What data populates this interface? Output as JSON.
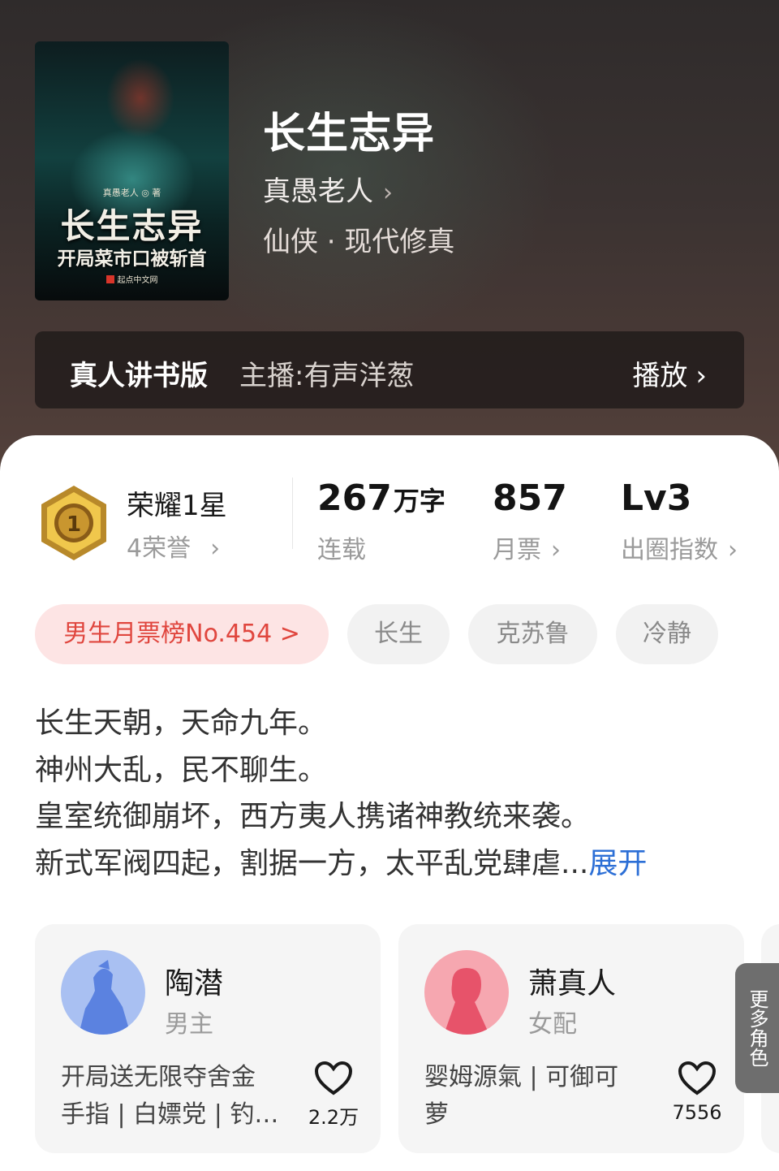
{
  "book": {
    "title": "长生志异",
    "author": "真愚老人",
    "genre": "仙侠 · 现代修真",
    "cover": {
      "author_line": "真愚老人 ◎ 著",
      "title": "长生志异",
      "subtitle": "开局菜市口被斩首",
      "publisher": "起点中文网"
    }
  },
  "audio": {
    "label": "真人讲书版",
    "anchor": "主播:有声洋葱",
    "play_label": "播放"
  },
  "honor": {
    "title": "荣耀1星",
    "sub": "4荣誉",
    "badge_number": "1"
  },
  "stats": [
    {
      "value": "267",
      "unit": "万字",
      "label": "连载"
    },
    {
      "value": "857",
      "unit": "",
      "label": "月票"
    },
    {
      "value": "Lv3",
      "unit": "",
      "label": "出圈指数"
    }
  ],
  "tags": [
    {
      "label": "男生月票榜No.454 >"
    },
    {
      "label": "长生"
    },
    {
      "label": "克苏鲁"
    },
    {
      "label": "冷静"
    }
  ],
  "synopsis": {
    "lines": [
      "长生天朝，天命九年。",
      "神州大乱，民不聊生。",
      "皇室统御崩坏，西方夷人携诸神教统来袭。",
      "新式军阀四起，割据一方，太平乱党肆虐..."
    ],
    "expand_label": "展开"
  },
  "characters": [
    {
      "name": "陶潜",
      "role": "男主",
      "desc_lines": [
        "开局送无限夺舍金",
        "手指 | 白嫖党 | 钓…"
      ],
      "likes": "2.2万"
    },
    {
      "name": "萧真人",
      "role": "女配",
      "desc_lines": [
        "婴姆源氣 | 可御可",
        "萝"
      ],
      "likes": "7556"
    }
  ],
  "more_roles_label": "更多角色",
  "colors": {
    "accent_blue": "#2c6fd6",
    "rank_red": "#e0463e",
    "rank_bg": "#fde4e4"
  }
}
